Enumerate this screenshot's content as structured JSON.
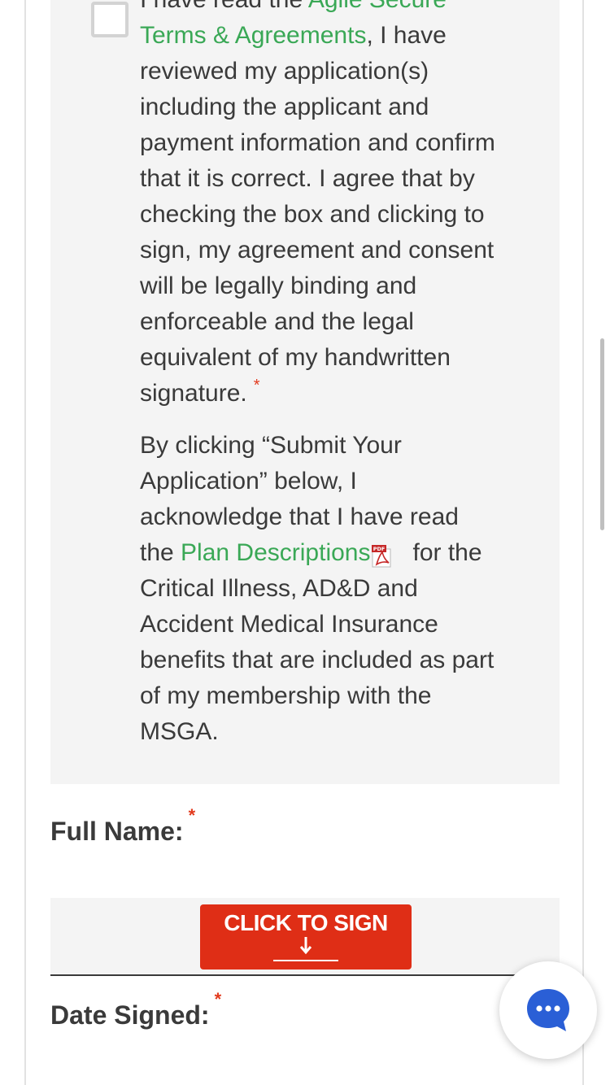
{
  "consent": {
    "para1_lead": "I have read the ",
    "terms_link": "Agile Secure Terms & Agreements",
    "para1_body": ", I have reviewed my application(s) including the applicant and payment information and confirm that it is correct. I agree that by checking the box and clicking to sign, my agreement and consent will be legally binding and enforceable and the legal equivalent of my handwritten signature.",
    "required_mark": "*",
    "para2_lead": "By clicking “Submit Your Application” below, I acknowledge that I have read the ",
    "plan_link": "Plan Descriptions",
    "pdf_badge": "PDF",
    "para2_tail": "for the Critical Illness, AD&D and Accident Medical Insurance benefits that are included as part of my membership with the MSGA."
  },
  "full_name": {
    "label": "Full Name:",
    "required_mark": "*"
  },
  "signature": {
    "button_label": "CLICK TO SIGN",
    "icon": "arrow-down-icon"
  },
  "date_signed": {
    "label": "Date Signed:",
    "required_mark": "*"
  },
  "chat": {
    "icon": "chat-icon"
  },
  "colors": {
    "link": "#3aa856",
    "required": "#e23a1e",
    "sign_button": "#df2e16",
    "chat_accent": "#2a5fd6",
    "panel": "#f4f4f4"
  }
}
